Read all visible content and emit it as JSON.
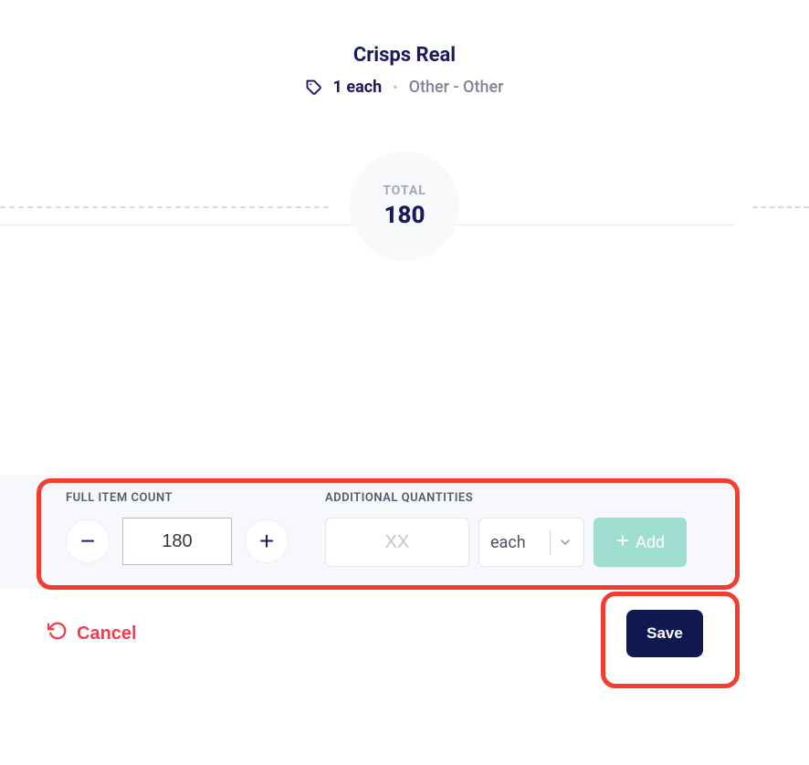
{
  "header": {
    "title": "Crisps Real",
    "quantity_text": "1 each",
    "category_text": "Other - Other"
  },
  "total": {
    "label": "TOTAL",
    "value": "180"
  },
  "full_count": {
    "label": "FULL ITEM COUNT",
    "value": "180"
  },
  "additional": {
    "label": "ADDITIONAL QUANTITIES",
    "placeholder": "XX",
    "unit": "each",
    "add_button": "Add"
  },
  "footer": {
    "cancel": "Cancel",
    "save": "Save"
  }
}
